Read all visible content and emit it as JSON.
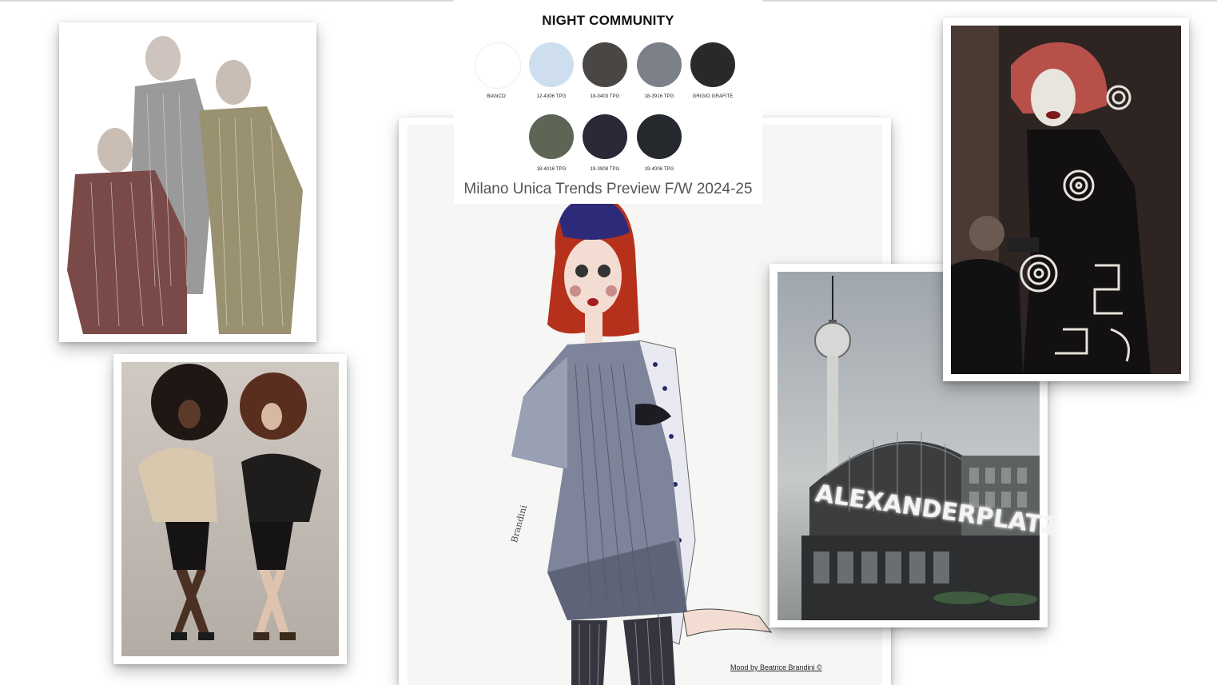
{
  "board": {
    "title": "NIGHT COMMUNITY",
    "subtitle": "Milano Unica Trends Preview F/W 2024-25",
    "credit": "Mood by Beatrice Brandini ©"
  },
  "palette": {
    "row1": [
      {
        "label": "BIANCO",
        "color": "#ffffff"
      },
      {
        "label": "12-4306 TPG",
        "color": "#cfdeef"
      },
      {
        "label": "18-0403 TPG",
        "color": "#4a4644"
      },
      {
        "label": "18-3916 TPG",
        "color": "#7c8088"
      },
      {
        "label": "GRIGIO GRAFITE",
        "color": "#2a2828"
      }
    ],
    "row2": [
      {
        "label": "18-4016 TPG",
        "color": "#5f6555"
      },
      {
        "label": "19-3908 TPG",
        "color": "#2b2838"
      },
      {
        "label": "19-4006 TPG",
        "color": "#25292d"
      }
    ]
  },
  "photos": {
    "sequins_trio": {
      "icon": "fashion-photo"
    },
    "afro_duo": {
      "icon": "fashion-photo"
    },
    "sketch": {
      "icon": "illustration",
      "signature": "Brandini"
    },
    "alexanderplatz": {
      "sign_text": "ALEXANDERPLATZ"
    },
    "bodypaint": {
      "icon": "fashion-photo"
    }
  }
}
